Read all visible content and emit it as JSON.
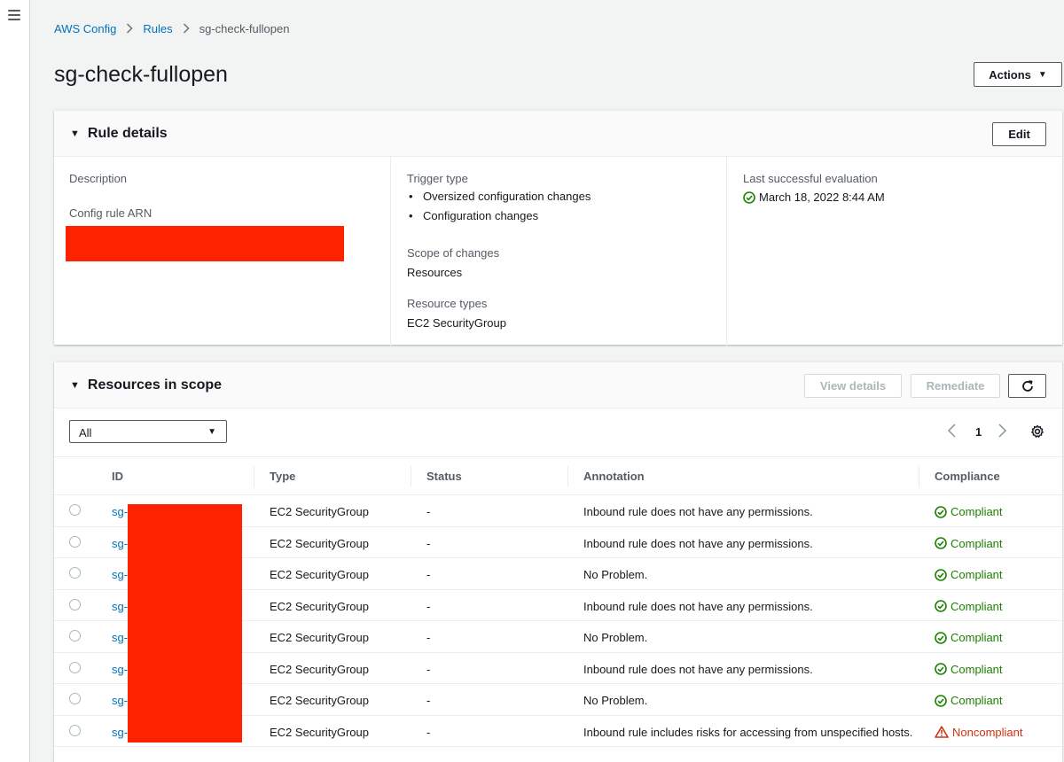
{
  "breadcrumb": {
    "items": [
      "AWS Config",
      "Rules"
    ],
    "current": "sg-check-fullopen"
  },
  "page": {
    "title": "sg-check-fullopen",
    "actions_label": "Actions"
  },
  "rule_details": {
    "title": "Rule details",
    "edit_label": "Edit",
    "description_label": "Description",
    "arn_label": "Config rule ARN",
    "trigger_type_label": "Trigger type",
    "trigger_types": [
      "Oversized configuration changes",
      "Configuration changes"
    ],
    "scope_label": "Scope of changes",
    "scope_value": "Resources",
    "resource_types_label": "Resource types",
    "resource_types_value": "EC2 SecurityGroup",
    "last_eval_label": "Last successful evaluation",
    "last_eval_value": "March 18, 2022 8:44 AM"
  },
  "resources": {
    "title": "Resources in scope",
    "view_details_label": "View details",
    "remediate_label": "Remediate",
    "filter_value": "All",
    "page_number": "1",
    "columns": [
      "ID",
      "Type",
      "Status",
      "Annotation",
      "Compliance"
    ],
    "rows": [
      {
        "id": "sg-",
        "type": "EC2 SecurityGroup",
        "status": "-",
        "annotation": "Inbound rule does not have any permissions.",
        "compliance": "Compliant"
      },
      {
        "id": "sg-",
        "type": "EC2 SecurityGroup",
        "status": "-",
        "annotation": "Inbound rule does not have any permissions.",
        "compliance": "Compliant"
      },
      {
        "id": "sg-",
        "type": "EC2 SecurityGroup",
        "status": "-",
        "annotation": "No Problem.",
        "compliance": "Compliant"
      },
      {
        "id": "sg-",
        "type": "EC2 SecurityGroup",
        "status": "-",
        "annotation": "Inbound rule does not have any permissions.",
        "compliance": "Compliant"
      },
      {
        "id": "sg-",
        "type": "EC2 SecurityGroup",
        "status": "-",
        "annotation": "No Problem.",
        "compliance": "Compliant"
      },
      {
        "id": "sg-",
        "type": "EC2 SecurityGroup",
        "status": "-",
        "annotation": "Inbound rule does not have any permissions.",
        "compliance": "Compliant"
      },
      {
        "id": "sg-",
        "type": "EC2 SecurityGroup",
        "status": "-",
        "annotation": "No Problem.",
        "compliance": "Compliant"
      },
      {
        "id": "sg-",
        "type": "EC2 SecurityGroup",
        "status": "-",
        "annotation": "Inbound rule includes risks for accessing from unspecified hosts.",
        "compliance": "Noncompliant"
      }
    ]
  },
  "colors": {
    "link": "#0073bb",
    "compliant": "#1d8102",
    "noncompliant": "#d13212",
    "redaction": "#ff2200"
  },
  "icons": {
    "menu": "hamburger-menu-icon",
    "compliant": "check-circle-icon",
    "noncompliant": "warning-triangle-icon",
    "refresh": "refresh-icon",
    "settings": "gear-icon"
  }
}
